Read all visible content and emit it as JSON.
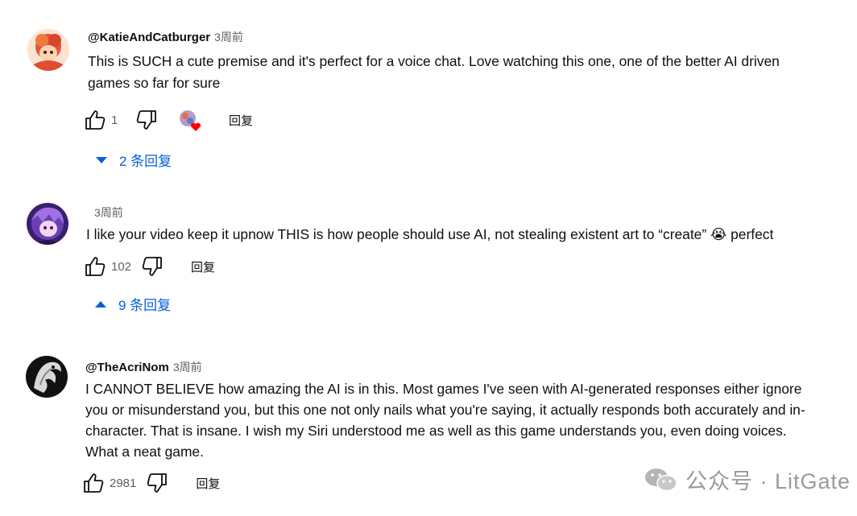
{
  "comments": [
    {
      "author": "@KatieAndCatburger",
      "time": "3周前",
      "lines": [
        "This is SUCH a cute premise and it's perfect for a voice chat. Love watching this one, one of the better AI driven",
        "games so far for sure"
      ],
      "likes": "1",
      "reply_label": "回复",
      "replies_label": "2 条回复",
      "replies_expanded": false,
      "creator_heart": true
    },
    {
      "author": "",
      "time": "3周前",
      "lines": [
        "I like your video keep it upnow THIS is how people should use AI, not stealing existent art to “create” 😭 perfect"
      ],
      "likes": "102",
      "reply_label": "回复",
      "replies_label": "9 条回复",
      "replies_expanded": true
    },
    {
      "author": "@TheAcriNom",
      "time": "3周前",
      "lines": [
        "I CANNOT BELIEVE how amazing the AI is in this. Most games I've seen with AI-generated responses either ignore",
        "you or misunderstand you, but this one not only nails what you're saying, it actually responds both accurately and in-",
        "character. That is insane. I wish my Siri understood me as well as this game understands you, even doing voices.",
        "What a neat game."
      ],
      "likes": "2981",
      "reply_label": "回复"
    }
  ],
  "watermark": {
    "text": "公众号 · LitGate"
  },
  "colors": {
    "link": "#065fd4",
    "secondary": "#606060",
    "heart": "#ff0000"
  }
}
